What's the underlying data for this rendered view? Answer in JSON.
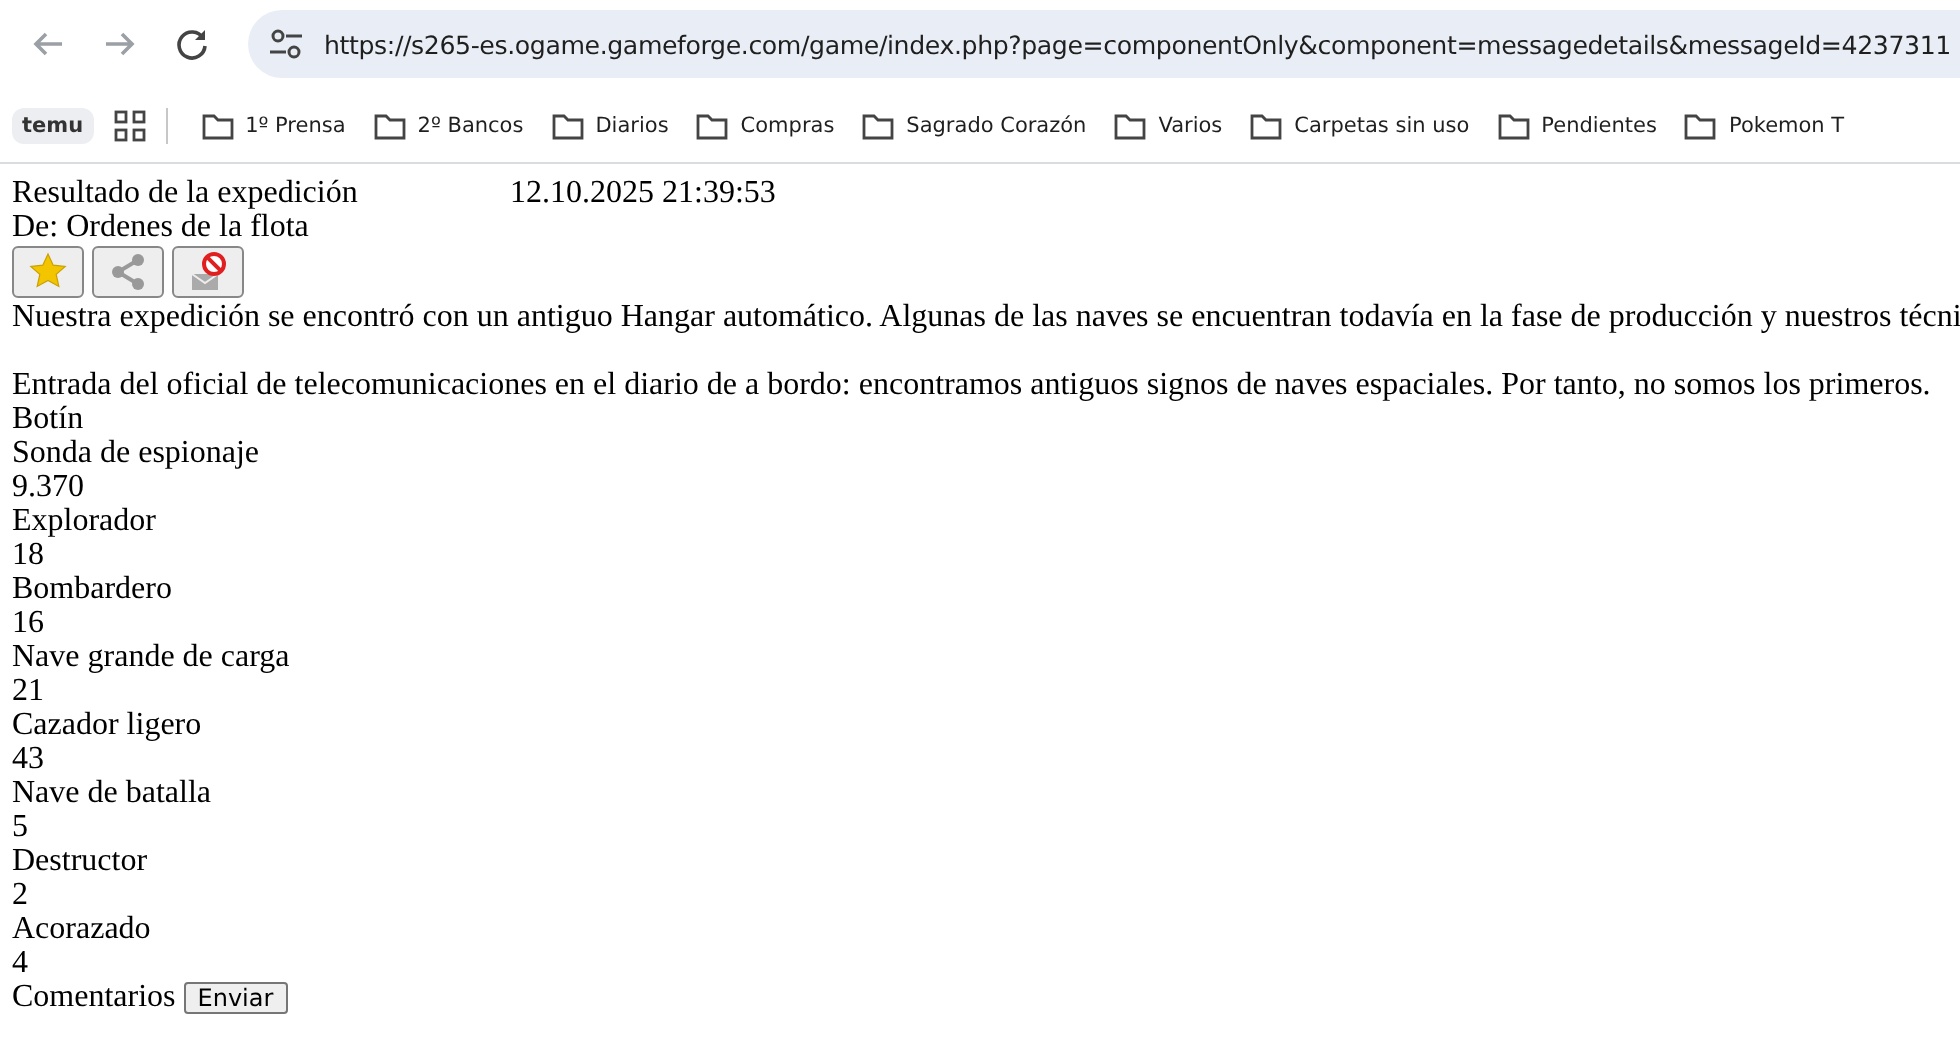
{
  "browser": {
    "url": "https://s265-es.ogame.gameforge.com/game/index.php?page=componentOnly&component=messagedetails&messageId=4237311"
  },
  "bookmarks": [
    {
      "kind": "app",
      "label": "temu"
    },
    {
      "kind": "grid"
    },
    {
      "kind": "folder",
      "label": "1º Prensa"
    },
    {
      "kind": "folder",
      "label": "2º Bancos"
    },
    {
      "kind": "folder",
      "label": "Diarios"
    },
    {
      "kind": "folder",
      "label": "Compras"
    },
    {
      "kind": "folder",
      "label": "Sagrado Corazón"
    },
    {
      "kind": "folder",
      "label": "Varios"
    },
    {
      "kind": "folder",
      "label": "Carpetas sin uso"
    },
    {
      "kind": "folder",
      "label": "Pendientes"
    },
    {
      "kind": "folder",
      "label": "Pokemon T"
    }
  ],
  "message": {
    "title": "Resultado de la expedición",
    "date": "12.10.2025 21:39:53",
    "from": "De: Ordenes de la flota",
    "actions": [
      {
        "kind": "favorite"
      },
      {
        "kind": "share"
      },
      {
        "kind": "report"
      }
    ],
    "body": "Nuestra expedición se encontró con un antiguo Hangar automático. Algunas de las naves se encuentran todavía en la fase de producción y nuestros técni",
    "log": "Entrada del oficial de telecomunicaciones en el diario de a bordo: encontramos antiguos signos de naves espaciales. Por tanto, no somos los primeros.",
    "loot_heading": "Botín",
    "ships": [
      {
        "name": "Sonda de espionaje",
        "count": "9.370"
      },
      {
        "name": "Explorador",
        "count": "18"
      },
      {
        "name": "Bombardero",
        "count": "16"
      },
      {
        "name": "Nave grande de carga",
        "count": "21"
      },
      {
        "name": "Cazador ligero",
        "count": "43"
      },
      {
        "name": "Nave de batalla",
        "count": "5"
      },
      {
        "name": "Destructor",
        "count": "2"
      },
      {
        "name": "Acorazado",
        "count": "4"
      }
    ],
    "comments_label": "Comentarios",
    "send_button": "Enviar"
  }
}
